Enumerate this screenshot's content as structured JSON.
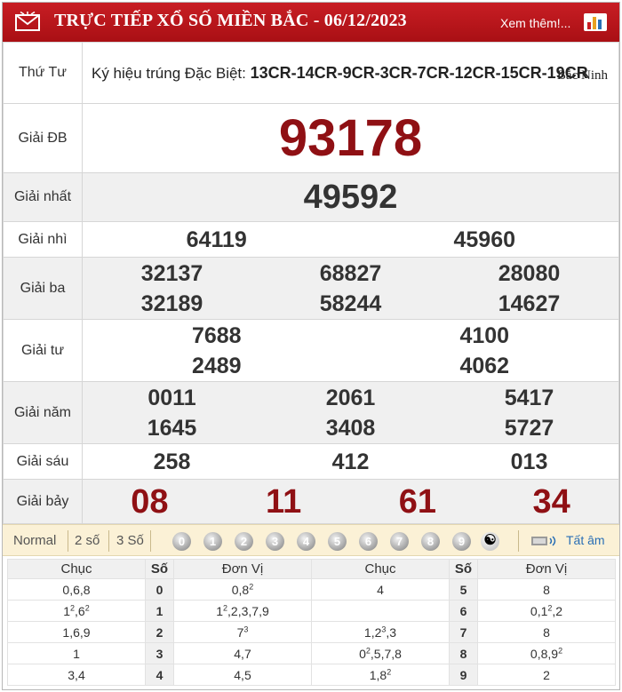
{
  "header": {
    "title": "TRỰC TIẾP XỔ SỐ MIỀN BẮC - 06/12/2023",
    "more_link": "Xem thêm!...",
    "colors": {
      "bar": "#c81e24",
      "accent": "#8f1014"
    }
  },
  "info": {
    "day": "Thứ Tư",
    "kyhieu_label": "Ký hiệu trúng Đặc Biệt:",
    "kyhieu_value": "13CR-14CR-9CR-3CR-7CR-12CR-15CR-19CR",
    "region": "Bắc Ninh"
  },
  "prizes": {
    "db": {
      "label": "Giải ĐB",
      "numbers": [
        "93178"
      ]
    },
    "nhat": {
      "label": "Giải nhất",
      "numbers": [
        "49592"
      ]
    },
    "nhi": {
      "label": "Giải nhì",
      "numbers": [
        "64119",
        "45960"
      ]
    },
    "ba": {
      "label": "Giải ba",
      "numbers": [
        "32137",
        "68827",
        "28080",
        "32189",
        "58244",
        "14627"
      ]
    },
    "tu": {
      "label": "Giải tư",
      "numbers": [
        "7688",
        "4100",
        "2489",
        "4062"
      ]
    },
    "nam": {
      "label": "Giải năm",
      "numbers": [
        "0011",
        "2061",
        "5417",
        "1645",
        "3408",
        "5727"
      ]
    },
    "sau": {
      "label": "Giải sáu",
      "numbers": [
        "258",
        "412",
        "013"
      ]
    },
    "bay": {
      "label": "Giải bảy",
      "numbers": [
        "08",
        "11",
        "61",
        "34"
      ]
    }
  },
  "toolbar": {
    "options": [
      "Normal",
      "2 số",
      "3 Số"
    ],
    "digits": [
      "0",
      "1",
      "2",
      "3",
      "4",
      "5",
      "6",
      "7",
      "8",
      "9"
    ],
    "yinyang": "☯",
    "play_all": "Tất âm",
    "icons": [
      "yin-yang-icon",
      "speaker-icon"
    ]
  },
  "loto": {
    "headers": [
      "Chục",
      "Số",
      "Đơn Vị",
      "Chục",
      "Số",
      "Đơn Vị"
    ],
    "rows": [
      {
        "chuc_l": "0,6,8",
        "so_l": "0",
        "dv_l": "0,8<sup>2</sup>",
        "chuc_r": "4",
        "so_r": "5",
        "dv_r": "8"
      },
      {
        "chuc_l": "1<sup>2</sup>,6<sup>2</sup>",
        "so_l": "1",
        "dv_l": "1<sup>2</sup>,2,3,7,9",
        "chuc_r": "",
        "so_r": "6",
        "dv_r": "0,1<sup>2</sup>,2"
      },
      {
        "chuc_l": "1,6,9",
        "so_l": "2",
        "dv_l": "7<sup>3</sup>",
        "chuc_r": "1,2<sup>3</sup>,3",
        "so_r": "7",
        "dv_r": "8"
      },
      {
        "chuc_l": "1",
        "so_l": "3",
        "dv_l": "4,7",
        "chuc_r": "0<sup>2</sup>,5,7,8",
        "so_r": "8",
        "dv_r": "0,8,9<sup>2</sup>"
      },
      {
        "chuc_l": "3,4",
        "so_l": "4",
        "dv_l": "4,5",
        "chuc_r": "1,8<sup>2</sup>",
        "so_r": "9",
        "dv_r": "2"
      }
    ]
  }
}
